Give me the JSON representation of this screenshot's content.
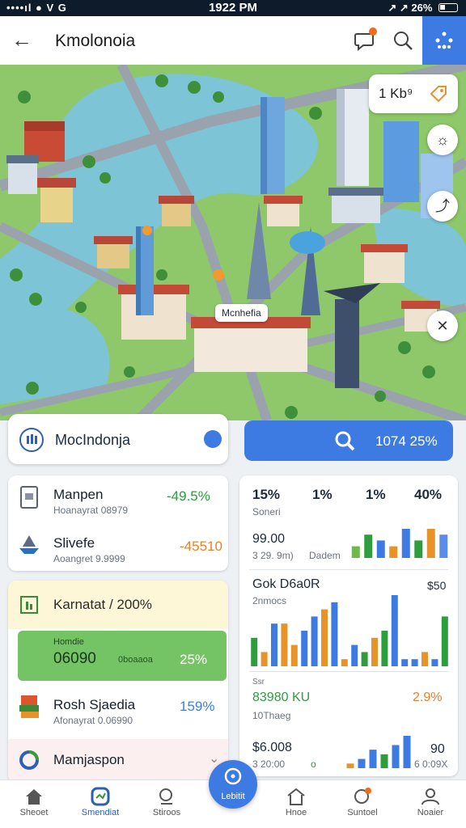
{
  "status_bar": {
    "left": "••••ıl ● V G",
    "time": "1922 PM",
    "right": "↗ ↗ 26%"
  },
  "app_bar": {
    "title": "Kmolonoia"
  },
  "map": {
    "kpi_chip": "1 Kb⁹",
    "label": "Mcnhefia"
  },
  "search": {
    "text": "MocIndonja",
    "result": "1074 25%"
  },
  "list": [
    {
      "title": "Manpen",
      "sub": "Hoanayrat 08979",
      "value": "-49.5%",
      "color": "#2e9d3e"
    },
    {
      "title": "Slivefe",
      "sub": "Aoangret 9.9999",
      "value": "-45510",
      "color": "#e8802a"
    }
  ],
  "summary": {
    "header": "Karnatat / 200%",
    "green_label": "Homdie",
    "green_value": "06090",
    "green_sub": "0boaaoa",
    "green_pct": "25%",
    "rows": [
      {
        "title": "Rosh Sjaedia",
        "sub": "Afonayrat 0.06990",
        "value": "159%"
      },
      {
        "title": "Mamjaspon",
        "sub": ""
      }
    ]
  },
  "chart_panel": {
    "top_pcts": [
      {
        "label": "15%",
        "color": "#7bb83a"
      },
      {
        "label": "1%",
        "color": "#3d7be3"
      },
      {
        "label": "1%",
        "color": "#2e9d3e"
      },
      {
        "label": "40%",
        "color": "#2e9d3e"
      }
    ],
    "top_sub": "Soneri",
    "mini": {
      "value": "99.00",
      "sub": "3 29. 9m)",
      "tag": "Dadem"
    },
    "big": {
      "title": "Gok D6a0R",
      "sub": "2nmocs",
      "right": "$50"
    },
    "row3": {
      "label": "Ssr",
      "value": "83980 KU",
      "sub": "10Thaeg",
      "pct": "2.9%"
    },
    "row4": {
      "value": "$6.008",
      "sub": "3 20:00",
      "right": "90",
      "right_sub": "6 0:09X",
      "o": "o"
    }
  },
  "chart_data": [
    {
      "type": "bar",
      "title": "",
      "series": [
        {
          "values": [
            2,
            5,
            3,
            4,
            6
          ],
          "color": null
        }
      ],
      "colors": [
        "#2e9d3e",
        "#6cbb4a",
        "#e8922a",
        "#3d7be3",
        "#5b8de8"
      ],
      "values": [
        2,
        4,
        3,
        2,
        5,
        3,
        5,
        4
      ]
    },
    {
      "type": "bar",
      "title": "Gok D6a0R",
      "values": [
        4,
        2,
        6,
        6,
        3,
        5,
        7,
        8,
        9,
        1,
        3,
        2,
        4,
        5,
        10,
        1,
        1,
        2,
        1,
        7
      ],
      "colors": [
        "#2e9d3e",
        "#e8922a",
        "#3d7be3",
        "#e8922a",
        "#e8922a",
        "#3d7be3",
        "#3d7be3",
        "#e8922a",
        "#3d7be3",
        "#e8922a",
        "#3d7be3",
        "#2e9d3e",
        "#e8922a",
        "#2e9d3e",
        "#3d7be3",
        "#3d7be3",
        "#3d7be3",
        "#e8922a",
        "#3d7be3",
        "#2e9d3e"
      ]
    },
    {
      "type": "bar",
      "title": "",
      "values": [
        1,
        2,
        4,
        3,
        5,
        7
      ],
      "colors": [
        "#e8922a",
        "#3d7be3",
        "#3d7be3",
        "#2e9d3e",
        "#3d7be3",
        "#3d7be3"
      ]
    }
  ],
  "nav": [
    {
      "label": "Sheoet",
      "icon": "home-icon",
      "active": false
    },
    {
      "label": "Smendiat",
      "icon": "badge-icon",
      "active": true
    },
    {
      "label": "Stiroos",
      "icon": "search-icon",
      "active": false
    },
    {
      "label": "Lebitit",
      "icon": "compass-icon",
      "active": true
    },
    {
      "label": "Hnoe",
      "icon": "house-icon",
      "active": false
    },
    {
      "label": "Suntoel",
      "icon": "notification-icon",
      "active": false
    },
    {
      "label": "Noaier",
      "icon": "profile-icon",
      "active": false
    }
  ]
}
